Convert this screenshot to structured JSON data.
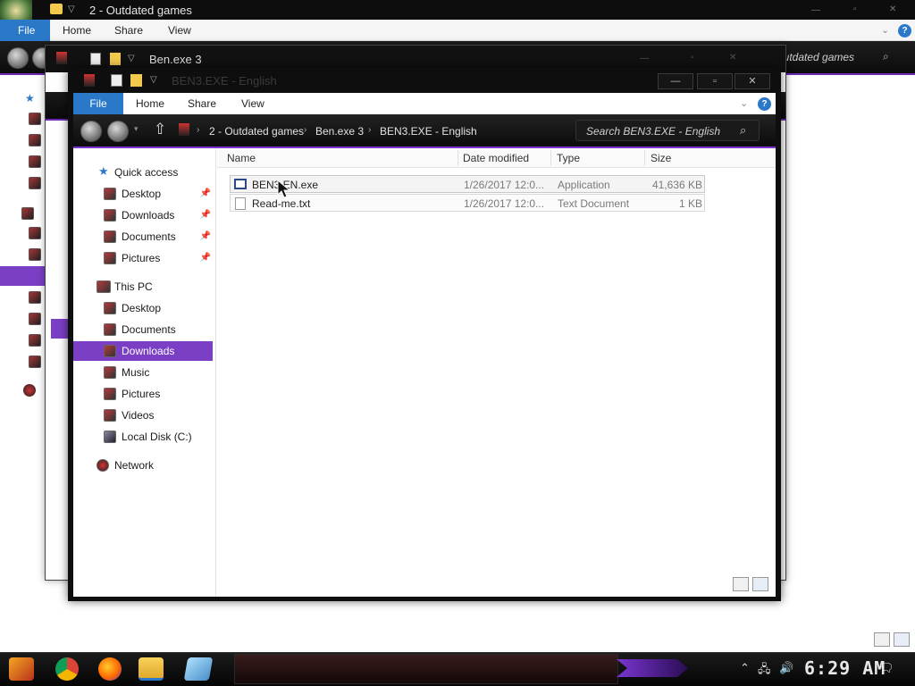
{
  "back_window": {
    "title": "2 - Outdated games",
    "ribbon": {
      "file": "File",
      "home": "Home",
      "share": "Share",
      "view": "View"
    },
    "search_placeholder": "2 - Outdated games"
  },
  "middle_window": {
    "title": "Ben.exe 3"
  },
  "front_window": {
    "title": "BEN3.EXE - English",
    "controls": {
      "minimize": "—",
      "maximize": "▫",
      "close": "✕"
    },
    "ribbon": {
      "file": "File",
      "home": "Home",
      "share": "Share",
      "view": "View"
    },
    "breadcrumb": [
      "2 - Outdated games",
      "Ben.exe 3",
      "BEN3.EXE - English"
    ],
    "search_placeholder": "Search BEN3.EXE - English",
    "nav_pane": {
      "quick_access": "Quick access",
      "quick_items": [
        "Desktop",
        "Downloads",
        "Documents",
        "Pictures"
      ],
      "this_pc": "This PC",
      "pc_items": [
        "Desktop",
        "Documents",
        "Downloads",
        "Music",
        "Pictures",
        "Videos",
        "Local Disk (C:)"
      ],
      "selected": "Downloads",
      "network": "Network"
    },
    "columns": [
      "Name",
      "Date modified",
      "Type",
      "Size"
    ],
    "files": [
      {
        "name": "BEN3 EN.exe",
        "date": "1/26/2017 12:0...",
        "type": "Application",
        "size": "41,636 KB"
      },
      {
        "name": "Read-me.txt",
        "date": "1/26/2017 12:0...",
        "type": "Text Document",
        "size": "1 KB"
      }
    ]
  },
  "taskbar": {
    "clock": "6:29 AM",
    "pinned_icons": [
      "start-icon",
      "chrome-icon",
      "firefox-icon",
      "file-explorer-icon",
      "notepad-icon"
    ],
    "tray_icons": [
      "chevron-up-icon",
      "network-icon",
      "volume-icon",
      "notification-icon"
    ]
  },
  "colors": {
    "accent_purple": "#7b3fc6",
    "file_tab_blue": "#2a78c8",
    "title_black": "#0e0e0e"
  }
}
